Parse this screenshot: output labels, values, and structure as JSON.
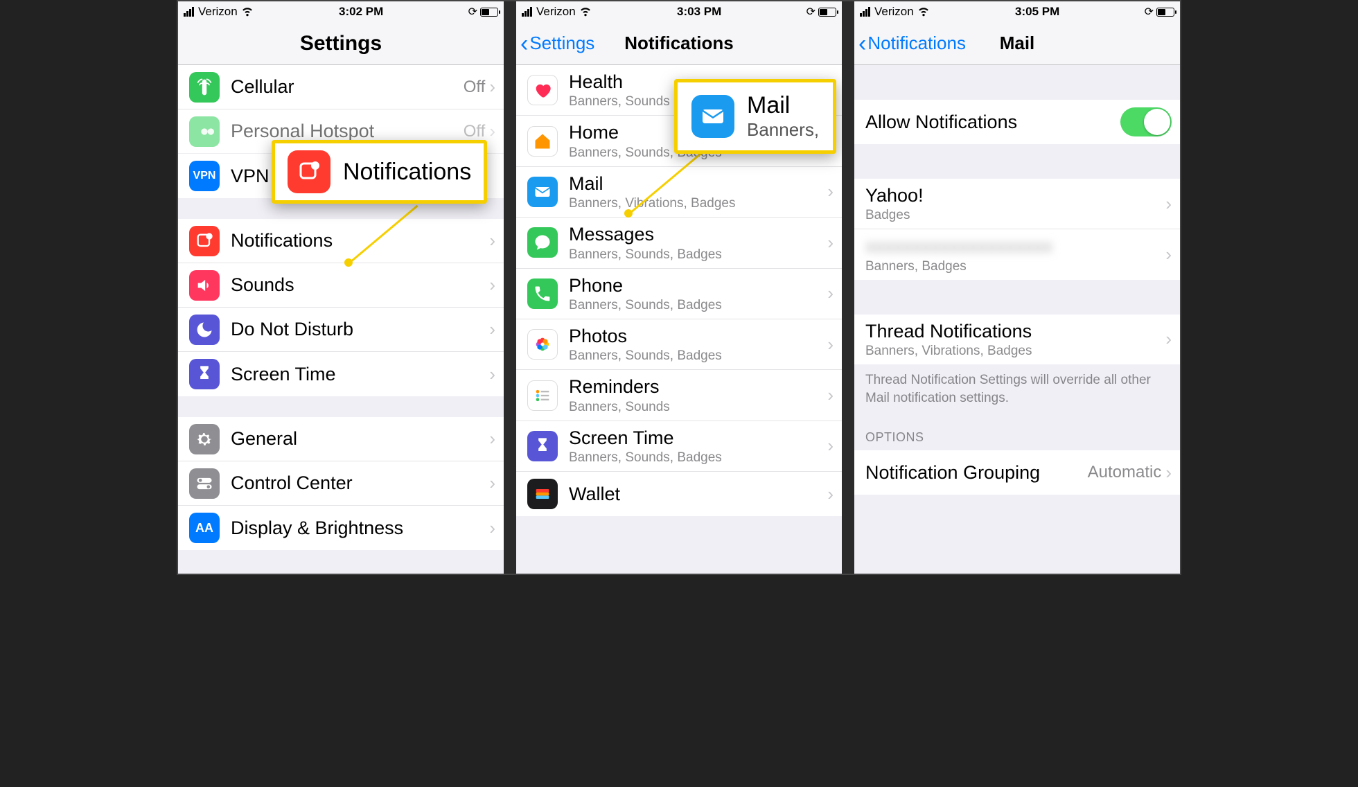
{
  "phones": [
    {
      "status": {
        "carrier": "Verizon",
        "time": "3:02 PM"
      },
      "title": "Settings",
      "rows": [
        {
          "label": "Cellular",
          "value": "Off"
        },
        {
          "label": "Personal Hotspot",
          "value": "Off"
        },
        {
          "label": "VPN"
        },
        {
          "label": "Notifications"
        },
        {
          "label": "Sounds"
        },
        {
          "label": "Do Not Disturb"
        },
        {
          "label": "Screen Time"
        },
        {
          "label": "General"
        },
        {
          "label": "Control Center"
        },
        {
          "label": "Display & Brightness"
        }
      ]
    },
    {
      "status": {
        "carrier": "Verizon",
        "time": "3:03 PM"
      },
      "back": "Settings",
      "title": "Notifications",
      "rows": [
        {
          "label": "Health",
          "sub": "Banners, Sounds"
        },
        {
          "label": "Home",
          "sub": "Banners, Sounds, Badges"
        },
        {
          "label": "Mail",
          "sub": "Banners, Vibrations, Badges"
        },
        {
          "label": "Messages",
          "sub": "Banners, Sounds, Badges"
        },
        {
          "label": "Phone",
          "sub": "Banners, Sounds, Badges"
        },
        {
          "label": "Photos",
          "sub": "Banners, Sounds, Badges"
        },
        {
          "label": "Reminders",
          "sub": "Banners, Sounds"
        },
        {
          "label": "Screen Time",
          "sub": "Banners, Sounds, Badges"
        },
        {
          "label": "Wallet"
        }
      ]
    },
    {
      "status": {
        "carrier": "Verizon",
        "time": "3:05 PM"
      },
      "back": "Notifications",
      "title": "Mail",
      "rows": [
        {
          "label": "Allow Notifications"
        },
        {
          "label": "Yahoo!",
          "sub": "Badges"
        },
        {
          "label": "",
          "sub": "Banners, Badges"
        },
        {
          "label": "Thread Notifications",
          "sub": "Banners, Vibrations, Badges"
        },
        {
          "label": "Notification Grouping",
          "value": "Automatic"
        }
      ],
      "footerNote": "Thread Notification Settings will override all other Mail notification settings.",
      "optionsHeader": "OPTIONS"
    }
  ],
  "callouts": [
    {
      "title": "Notifications"
    },
    {
      "title": "Mail",
      "sub": "Banners,"
    }
  ]
}
